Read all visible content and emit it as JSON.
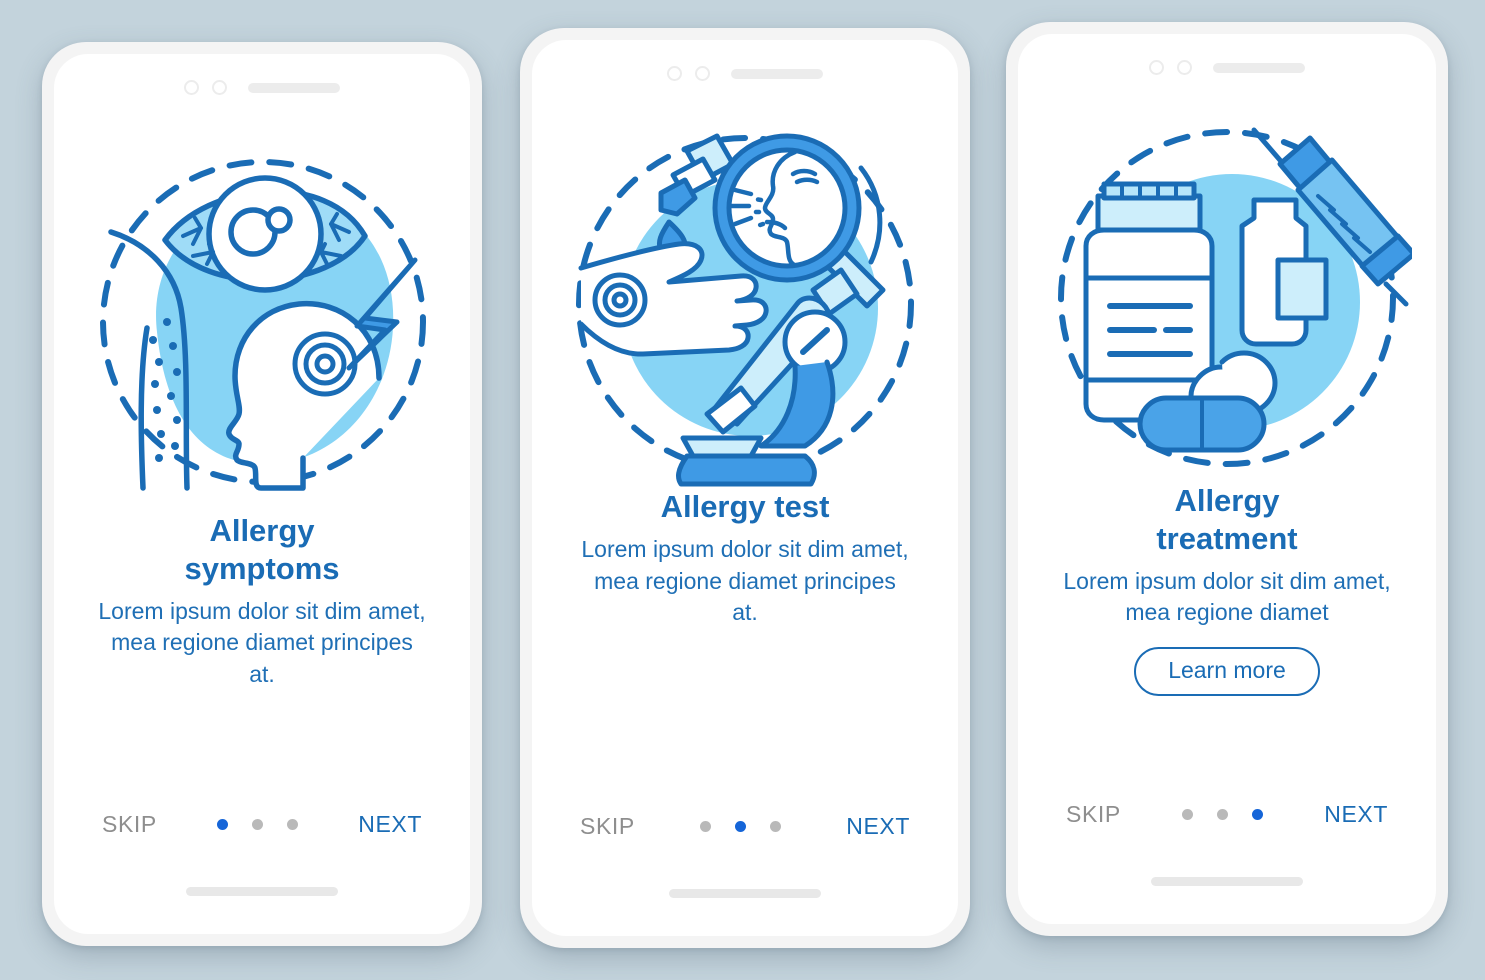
{
  "background_color": "#c3d3dc",
  "theme": {
    "primary_blue": "#1a6cb5",
    "accent_blue": "#3f9ae5",
    "blob_blue": "#87d4f5",
    "pale_blue": "#cdeefb",
    "dot_active": "#1565d8",
    "dot_inactive": "#b9b9b9",
    "skip_gray": "#8e8e8e",
    "phone_bezel": "#f4f4f4",
    "screen_white": "#ffffff"
  },
  "phone_chrome": {
    "camera_icon": "camera-ring-icon",
    "sensor_icon": "sensor-ring-icon",
    "speaker_icon": "speaker-bar-icon",
    "home_indicator_icon": "home-indicator-bar"
  },
  "screens": [
    {
      "id": "allergy-symptoms",
      "illustration": "allergy-symptoms-illustration",
      "illustration_parts": [
        "eye-icon",
        "rash-arm-icon",
        "head-profile-icon",
        "headache-target-icon",
        "lightning-bolt-icon",
        "dashed-circle",
        "blue-blob"
      ],
      "title": "Allergy\nsymptoms",
      "title_lines": [
        "Allergy",
        "symptoms"
      ],
      "subtitle": "Lorem ipsum dolor sit dim amet, mea regione diamet principes at.",
      "subtitle_lines": [
        "Lorem ipsum dolor sit dim",
        "amet, mea regione diamet",
        "principes at."
      ],
      "has_learn_more": false,
      "learn_more_label": "",
      "skip_label": "SKIP",
      "next_label": "NEXT",
      "dots_total": 3,
      "active_dot": 0
    },
    {
      "id": "allergy-test",
      "illustration": "allergy-test-illustration",
      "illustration_parts": [
        "dropper-icon",
        "droplet-icon",
        "hand-icon",
        "allergy-mark-icon",
        "magnifier-icon",
        "sneezing-face-icon",
        "microscope-icon",
        "dashed-circle",
        "blue-blob"
      ],
      "title": "Allergy test",
      "title_lines": [
        "Allergy test"
      ],
      "subtitle": "Lorem ipsum dolor sit dim amet, mea regione diamet principes at.",
      "subtitle_lines": [
        "Lorem ipsum dolor sit dim",
        "amet, mea regione diamet",
        "principes at."
      ],
      "has_learn_more": false,
      "learn_more_label": "",
      "skip_label": "SKIP",
      "next_label": "NEXT",
      "dots_total": 3,
      "active_dot": 1
    },
    {
      "id": "allergy-treatment",
      "illustration": "allergy-treatment-illustration",
      "illustration_parts": [
        "pill-bottle-icon",
        "medicine-vial-icon",
        "syringe-icon",
        "capsule-icon",
        "dashed-circle",
        "blue-blob"
      ],
      "title": "Allergy\ntreatment",
      "title_lines": [
        "Allergy",
        "treatment"
      ],
      "subtitle": "Lorem ipsum dolor sit dim amet, mea regione diamet",
      "subtitle_lines": [
        "Lorem ipsum dolor sit dim",
        "amet, mea regione diamet"
      ],
      "has_learn_more": true,
      "learn_more_label": "Learn more",
      "skip_label": "SKIP",
      "next_label": "NEXT",
      "dots_total": 3,
      "active_dot": 2
    }
  ]
}
